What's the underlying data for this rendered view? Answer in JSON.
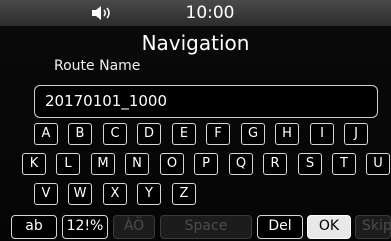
{
  "status_bar": {
    "volume_icon": "speaker-volume-icon",
    "time": "10:00"
  },
  "header": {
    "title": "Navigation"
  },
  "form": {
    "field_label": "Route Name",
    "field_value": "20170101_1000"
  },
  "keyboard": {
    "row1": [
      "A",
      "B",
      "C",
      "D",
      "E",
      "F",
      "G",
      "H",
      "I",
      "J"
    ],
    "row2": [
      "K",
      "L",
      "M",
      "N",
      "O",
      "P",
      "Q",
      "R",
      "S",
      "T",
      "U"
    ],
    "row3": [
      "V",
      "W",
      "X",
      "Y",
      "Z"
    ]
  },
  "function_keys": {
    "lowercase": "ab",
    "symbols": "12!%",
    "accents": "ÀÖ",
    "space": "Space",
    "delete": "Del",
    "ok": "OK",
    "skip": "Skip"
  },
  "colors": {
    "background": "#000000",
    "statusbar": "#3a3a3a",
    "key_border": "#d6d6d6",
    "disabled_key": "#1c1c1c",
    "selected_key": "#e8e8e8"
  }
}
